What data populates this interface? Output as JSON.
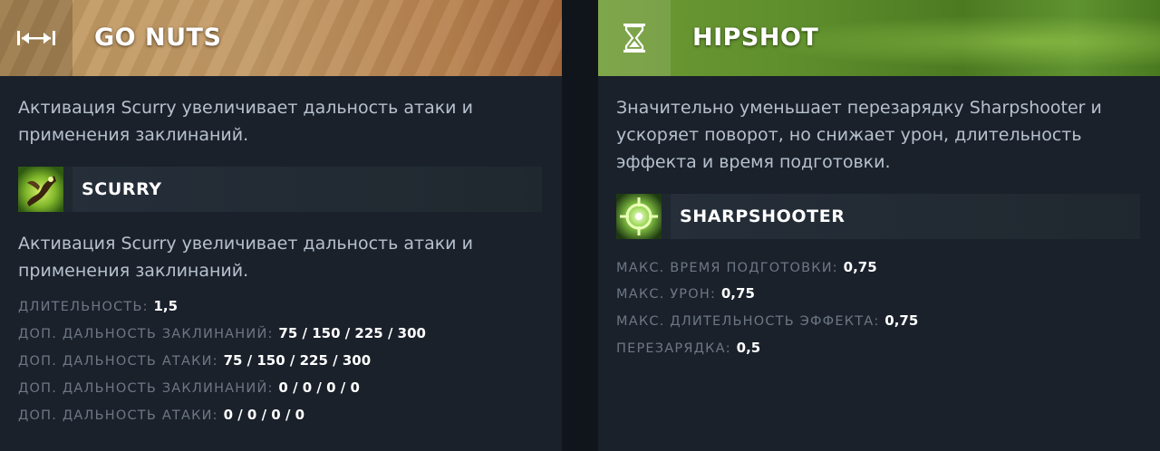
{
  "left_facet": {
    "title": "GO NUTS",
    "icon": "arrows-horizontal-icon",
    "description": "Активация Scurry увеличивает дальность атаки и применения заклинаний.",
    "ability": {
      "name": "SCURRY",
      "icon": "scurry-ability-icon",
      "description": "Активация Scurry увеличивает дальность атаки и применения заклинаний."
    },
    "stats": [
      {
        "label": "ДЛИТЕЛЬНОСТЬ:",
        "value": "1,5"
      },
      {
        "label": "ДОП. ДАЛЬНОСТЬ ЗАКЛИНАНИЙ:",
        "value": "75 / 150 / 225 / 300"
      },
      {
        "label": "ДОП. ДАЛЬНОСТЬ АТАКИ:",
        "value": "75 / 150 / 225 / 300"
      },
      {
        "label": "ДОП. ДАЛЬНОСТЬ ЗАКЛИНАНИЙ:",
        "value": "0 / 0 / 0 / 0"
      },
      {
        "label": "ДОП. ДАЛЬНОСТЬ АТАКИ:",
        "value": "0 / 0 / 0 / 0"
      }
    ]
  },
  "right_facet": {
    "title": "HIPSHOT",
    "icon": "hourglass-icon",
    "description": "Значительно уменьшает перезарядку Sharpshooter и ускоряет поворот, но снижает урон, длительность эффекта и время подготовки.",
    "ability": {
      "name": "SHARPSHOOTER",
      "icon": "sharpshooter-ability-icon"
    },
    "stats": [
      {
        "label": "МАКС. ВРЕМЯ ПОДГОТОВКИ:",
        "value": "0,75"
      },
      {
        "label": "МАКС. УРОН:",
        "value": "0,75"
      },
      {
        "label": "МАКС. ДЛИТЕЛЬНОСТЬ ЭФФЕКТА:",
        "value": "0,75"
      },
      {
        "label": "ПЕРЕЗАРЯДКА:",
        "value": "0,5"
      }
    ]
  },
  "colors": {
    "panel_bg": "#1a212b",
    "text_desc": "#b6c1cd",
    "text_label": "#6d7884",
    "left_header": "#c39a66",
    "right_header": "#5e8e2c"
  }
}
